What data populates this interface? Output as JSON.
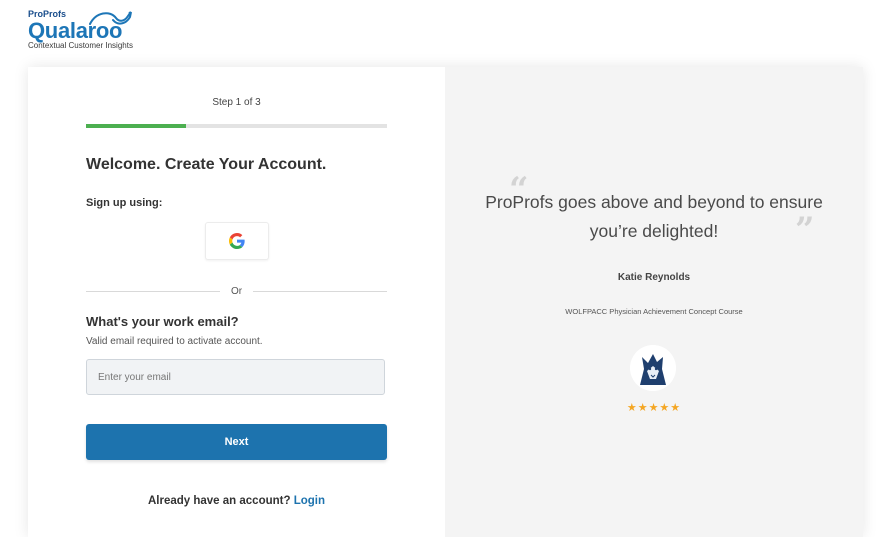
{
  "logo": {
    "company": "ProProfs",
    "brand": "Qualaroo",
    "tagline": "Contextual Customer Insights"
  },
  "signup": {
    "step_label": "Step 1 of 3",
    "progress_fraction": 0.333,
    "title": "Welcome. Create Your Account.",
    "signup_using_label": "Sign up using:",
    "google_icon": "google-icon",
    "divider_text": "Or",
    "email_question": "What's your work email?",
    "email_hint": "Valid email required to activate account.",
    "email_placeholder": "Enter your email",
    "email_value": "",
    "next_label": "Next",
    "login_prompt": "Already have an account?",
    "login_link": "Login"
  },
  "testimonial": {
    "quote": "ProProfs goes above and beyond to ensure you’re delighted!",
    "author": "Katie Reynolds",
    "organization": "WOLFPACC Physician Achievement Concept Course",
    "rating": 5,
    "stars": "★★★★★"
  },
  "colors": {
    "accent": "#1d73ae",
    "progress": "#4caf50",
    "star": "#f4a623",
    "right_panel_bg": "#f4f4f4"
  }
}
